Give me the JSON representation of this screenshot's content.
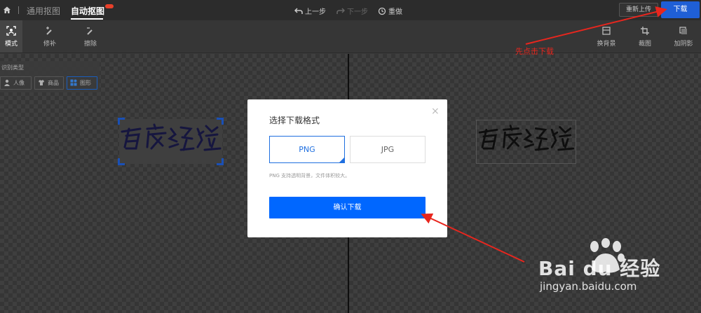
{
  "topbar": {
    "tabs": [
      {
        "label": "通用抠图"
      },
      {
        "label": "自动抠图"
      }
    ],
    "undo_label": "上一步",
    "redo_label": "下一步",
    "reset_label": "重做",
    "reupload_label": "重新上传",
    "download_label": "下载"
  },
  "toolbar": {
    "left": [
      {
        "label": "模式"
      },
      {
        "label": "修补"
      },
      {
        "label": "擦除"
      }
    ],
    "right": [
      {
        "label": "换背景"
      },
      {
        "label": "裁图"
      },
      {
        "label": "加阴影"
      }
    ]
  },
  "recognition": {
    "title": "识别类型",
    "options": [
      {
        "label": "人像"
      },
      {
        "label": "商品"
      },
      {
        "label": "图形"
      }
    ],
    "selected": "图形"
  },
  "modal": {
    "title": "选择下载格式",
    "close": "×",
    "formats": [
      {
        "label": "PNG",
        "selected": true
      },
      {
        "label": "JPG",
        "selected": false
      }
    ],
    "note": "PNG 支持透明背景，文件体积较大。",
    "confirm_label": "确认下载"
  },
  "annotation": {
    "text": "先点击下载"
  },
  "signature_logo_text": "百度经验",
  "watermark": {
    "logo": "Bai du 经验",
    "url": "jingyan.baidu.com"
  },
  "colors": {
    "accent": "#1f6fe0",
    "confirm": "#0067ff",
    "annotation": "#e8261e"
  }
}
